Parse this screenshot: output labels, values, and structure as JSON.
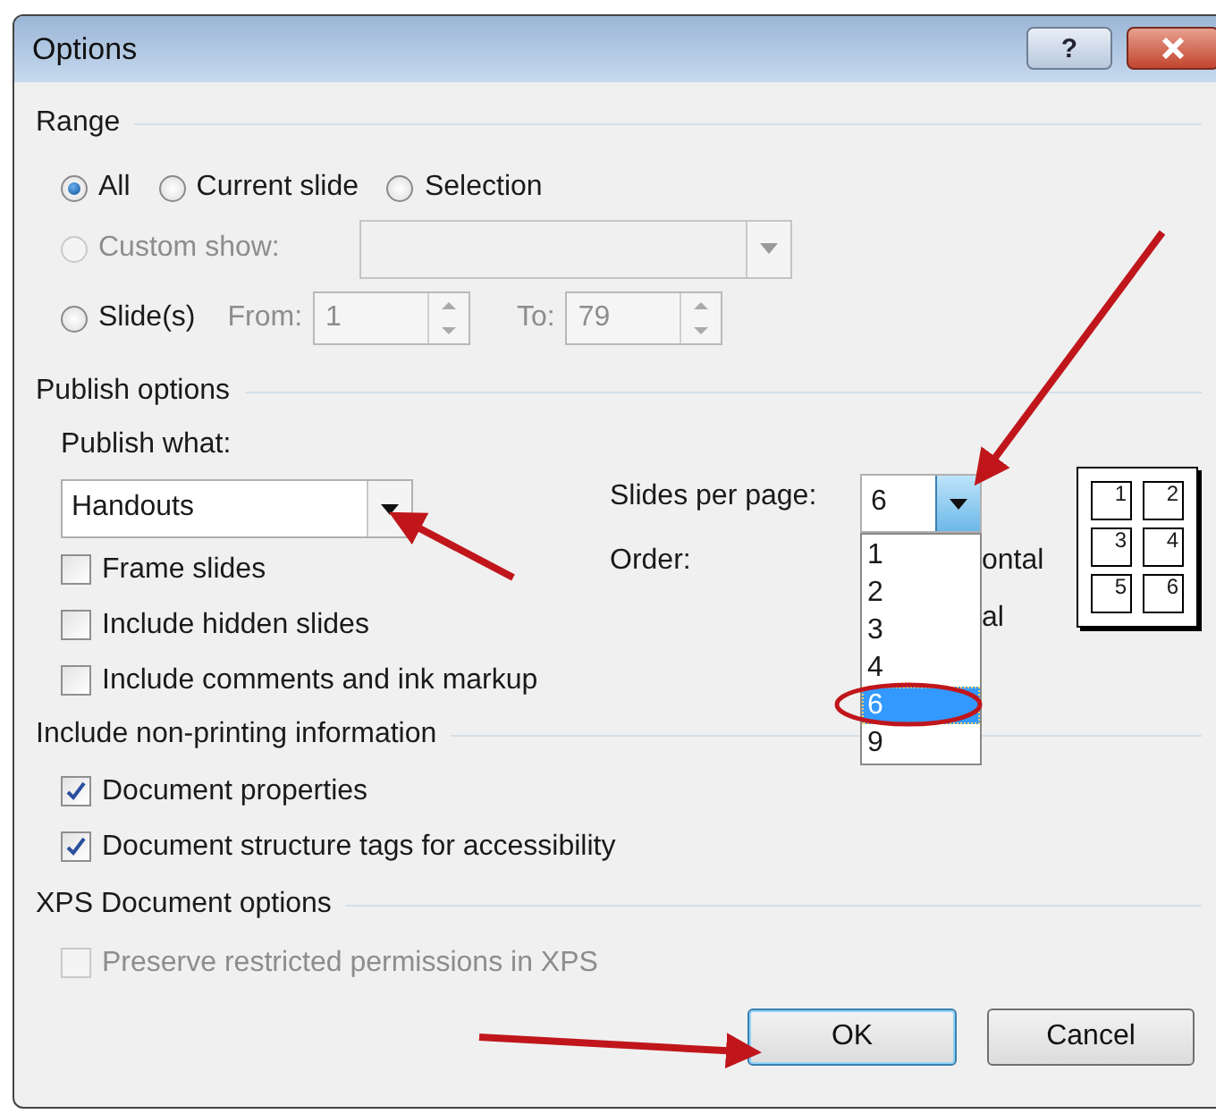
{
  "window": {
    "title": "Options",
    "help_button": "?"
  },
  "range": {
    "title": "Range",
    "radios": [
      {
        "label": "All",
        "selected": true
      },
      {
        "label": "Current slide",
        "selected": false
      },
      {
        "label": "Selection",
        "selected": false
      }
    ],
    "custom_show": {
      "label": "Custom show:",
      "selected": false,
      "disabled": true
    },
    "slides": {
      "label": "Slide(s)",
      "selected": false,
      "from_label": "From:",
      "from_value": "1",
      "to_label": "To:",
      "to_value": "79"
    }
  },
  "publish": {
    "title": "Publish options",
    "what_label": "Publish what:",
    "what_value": "Handouts",
    "checkboxes": [
      {
        "label": "Frame slides",
        "checked": false
      },
      {
        "label": "Include hidden slides",
        "checked": false
      },
      {
        "label": "Include comments and ink markup",
        "checked": false
      }
    ],
    "slides_per_page_label": "Slides per page:",
    "slides_per_page_value": "6",
    "dropdown_items": [
      {
        "label": "1",
        "selected": false
      },
      {
        "label": "2",
        "selected": false
      },
      {
        "label": "3",
        "selected": false
      },
      {
        "label": "4",
        "selected": false
      },
      {
        "label": "6",
        "selected": true
      },
      {
        "label": "9",
        "selected": false
      }
    ],
    "order_label": "Order:",
    "order_options": [
      "ontal",
      "al"
    ],
    "preview_numbers": [
      "1",
      "2",
      "3",
      "4",
      "5",
      "6"
    ]
  },
  "nonprinting": {
    "title": "Include non-printing information",
    "checkboxes": [
      {
        "label": "Document properties",
        "checked": true
      },
      {
        "label": "Document structure tags for accessibility",
        "checked": true
      }
    ]
  },
  "xps": {
    "title": "XPS Document options",
    "checkboxes": [
      {
        "label": "Preserve restricted permissions in XPS",
        "checked": false,
        "disabled": true
      }
    ]
  },
  "buttons": [
    {
      "label": "OK",
      "default": true
    },
    {
      "label": "Cancel",
      "default": false
    }
  ]
}
